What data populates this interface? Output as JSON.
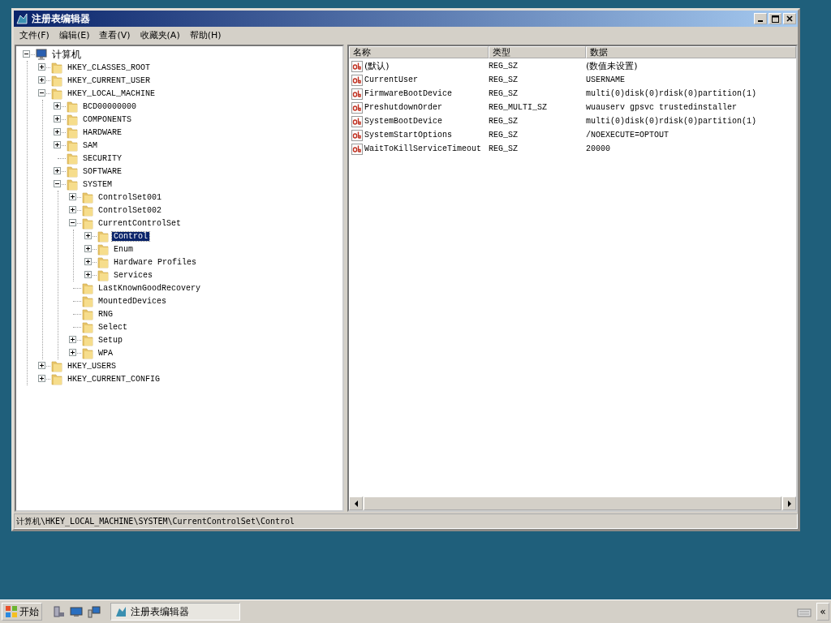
{
  "window": {
    "title": "注册表编辑器"
  },
  "menu": [
    "文件(F)",
    "编辑(E)",
    "查看(V)",
    "收藏夹(A)",
    "帮助(H)"
  ],
  "tree": {
    "label": "计算机",
    "kind": "computer",
    "expanded": true,
    "selected": false,
    "children": [
      {
        "label": "HKEY_CLASSES_ROOT",
        "kind": "branch",
        "expanded": false,
        "selected": false
      },
      {
        "label": "HKEY_CURRENT_USER",
        "kind": "branch",
        "expanded": false,
        "selected": false
      },
      {
        "label": "HKEY_LOCAL_MACHINE",
        "kind": "branch",
        "expanded": true,
        "selected": false,
        "children": [
          {
            "label": "BCD00000000",
            "kind": "branch",
            "expanded": false,
            "selected": false
          },
          {
            "label": "COMPONENTS",
            "kind": "branch",
            "expanded": false,
            "selected": false
          },
          {
            "label": "HARDWARE",
            "kind": "branch",
            "expanded": false,
            "selected": false
          },
          {
            "label": "SAM",
            "kind": "branch",
            "expanded": false,
            "selected": false
          },
          {
            "label": "SECURITY",
            "kind": "leaf",
            "selected": false
          },
          {
            "label": "SOFTWARE",
            "kind": "branch",
            "expanded": false,
            "selected": false
          },
          {
            "label": "SYSTEM",
            "kind": "branch",
            "expanded": true,
            "selected": false,
            "children": [
              {
                "label": "ControlSet001",
                "kind": "branch",
                "expanded": false,
                "selected": false
              },
              {
                "label": "ControlSet002",
                "kind": "branch",
                "expanded": false,
                "selected": false
              },
              {
                "label": "CurrentControlSet",
                "kind": "branch",
                "expanded": true,
                "selected": false,
                "children": [
                  {
                    "label": "Control",
                    "kind": "branch",
                    "expanded": false,
                    "selected": true
                  },
                  {
                    "label": "Enum",
                    "kind": "branch",
                    "expanded": false,
                    "selected": false
                  },
                  {
                    "label": "Hardware Profiles",
                    "kind": "branch",
                    "expanded": false,
                    "selected": false
                  },
                  {
                    "label": "Services",
                    "kind": "branch",
                    "expanded": false,
                    "selected": false
                  }
                ]
              },
              {
                "label": "LastKnownGoodRecovery",
                "kind": "leaf",
                "selected": false
              },
              {
                "label": "MountedDevices",
                "kind": "leaf",
                "selected": false
              },
              {
                "label": "RNG",
                "kind": "leaf",
                "selected": false
              },
              {
                "label": "Select",
                "kind": "leaf",
                "selected": false
              },
              {
                "label": "Setup",
                "kind": "branch",
                "expanded": false,
                "selected": false
              },
              {
                "label": "WPA",
                "kind": "branch",
                "expanded": false,
                "selected": false
              }
            ]
          }
        ]
      },
      {
        "label": "HKEY_USERS",
        "kind": "branch",
        "expanded": false,
        "selected": false
      },
      {
        "label": "HKEY_CURRENT_CONFIG",
        "kind": "branch",
        "expanded": false,
        "selected": false
      }
    ]
  },
  "values": {
    "columns": [
      "名称",
      "类型",
      "数据"
    ],
    "rows": [
      {
        "name": "(默认)",
        "type": "REG_SZ",
        "data": "(数值未设置)"
      },
      {
        "name": "CurrentUser",
        "type": "REG_SZ",
        "data": "USERNAME"
      },
      {
        "name": "FirmwareBootDevice",
        "type": "REG_SZ",
        "data": "multi(0)disk(0)rdisk(0)partition(1)"
      },
      {
        "name": "PreshutdownOrder",
        "type": "REG_MULTI_SZ",
        "data": "wuauserv gpsvc trustedinstaller"
      },
      {
        "name": "SystemBootDevice",
        "type": "REG_SZ",
        "data": "multi(0)disk(0)rdisk(0)partition(1)"
      },
      {
        "name": "SystemStartOptions",
        "type": "REG_SZ",
        "data": "/NOEXECUTE=OPTOUT"
      },
      {
        "name": "WaitToKillServiceTimeout",
        "type": "REG_SZ",
        "data": "20000"
      }
    ]
  },
  "status_bar": "计算机\\HKEY_LOCAL_MACHINE\\SYSTEM\\CurrentControlSet\\Control",
  "taskbar": {
    "start": "开始",
    "tasks": [
      {
        "label": "注册表编辑器",
        "selected": true
      }
    ],
    "tray_button": "«"
  }
}
